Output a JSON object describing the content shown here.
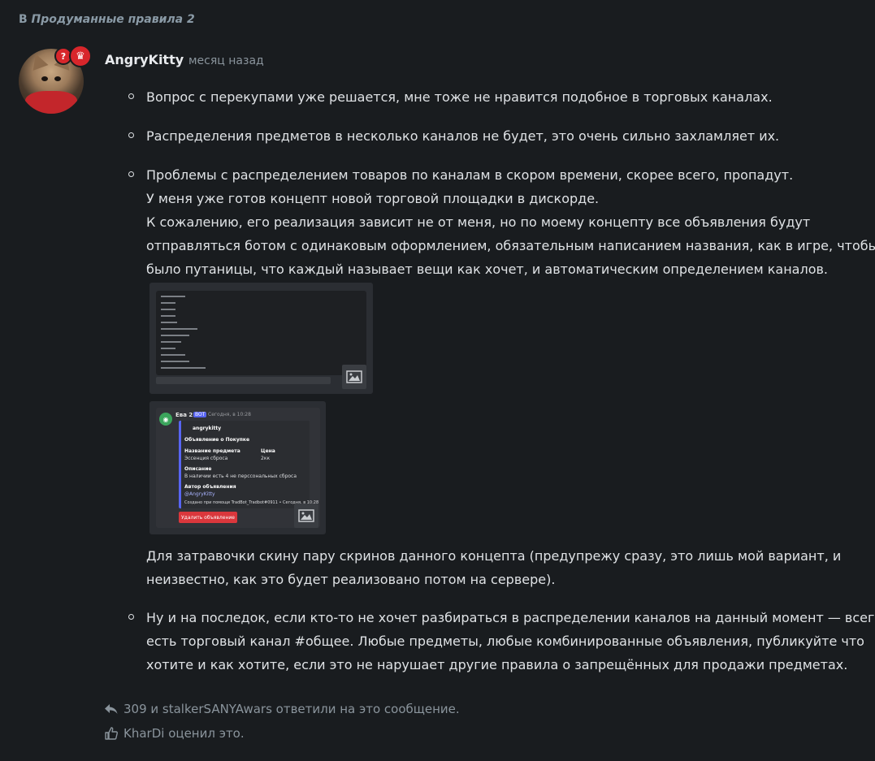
{
  "breadcrumb": {
    "prefix": "В",
    "thread": "Продуманные правила 2"
  },
  "post": {
    "author": "AngryKitty",
    "time": "месяц назад",
    "badges": [
      "?",
      "crown-icon"
    ],
    "items": [
      {
        "lines": [
          "Вопрос с перекупами уже решается, мне тоже не нравится подобное в торговых каналах."
        ]
      },
      {
        "lines": [
          "Распределения предметов в несколько каналов не будет, это очень сильно захламляет их."
        ]
      },
      {
        "lines": [
          "Проблемы с распределением товаров по каналам в скором времени, скорее всего, пропадут.",
          "У меня уже готов концепт новой торговой площадки в дискорде.",
          "К сожалению, его реализация зависит не от меня, но по моему концепту все объявления будут",
          "отправляться ботом с одинаковым оформлением, обязательным написанием названия, как в игре, чтобы не",
          "было путаницы, что каждый называет вещи как хочет, и автоматическим определением каналов."
        ]
      }
    ],
    "after_images": [
      "Для затравочки скину пару скринов данного концепта (предупрежу сразу, это лишь мой вариант, и",
      "неизвестно, как это будет реализовано потом на сервере)."
    ],
    "last_item": [
      "Ну и на последок, если кто-то не хочет разбираться в распределении каналов на данный момент — всегда",
      "есть торговый канал #общее. Любые предметы, любые комбинированные объявления, публикуйте что",
      "хотите и как хотите, если это не нарушает другие правила о запрещённых для продажи предметах."
    ]
  },
  "screenshot2": {
    "bot_name": "Ева 2.0",
    "bot_tag": "BOT",
    "bot_time": "Сегодня, в 10:28",
    "embed_author": "angrykitty",
    "embed_title": "Объявление о Покупке",
    "field1_name": "Название предмета",
    "field1_value": "Эссенция сброса",
    "field2_name": "Цена",
    "field2_value": "2кк",
    "desc_name": "Описание",
    "desc_value": "В наличии есть 4 не перссональных сброса",
    "author_name": "Автор объявления",
    "author_value": "@AngryKitty",
    "footer": "Создано при помощи TradBot_Tradbot#0911 • Сегодня, в 10:28",
    "delete_button": "Удалить объявление"
  },
  "reactions": {
    "replies": "309 и stalkerSANYAwars ответили на это сообщение.",
    "likes": "KharDi оценил это."
  }
}
